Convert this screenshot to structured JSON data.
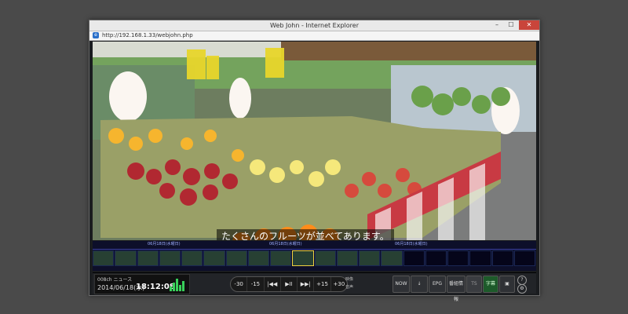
{
  "window": {
    "title": "Web John - Internet Explorer",
    "minimize": "–",
    "maximize": "☐",
    "close": "✕"
  },
  "address": {
    "ie_icon": "e",
    "url": "http://192.168.1.33/webjohn.php"
  },
  "video": {
    "subtitle": "たくさんのフルーツが並べてあります。"
  },
  "timeline": {
    "ruler_labels": [
      "06月18日(水曜日)",
      "06月18日(水曜日)",
      "06月18日(水曜日)"
    ],
    "thumbnails": [
      "frame",
      "frame",
      "frame",
      "frame",
      "frame",
      "frame",
      "frame",
      "frame",
      "frame",
      "current",
      "frame",
      "frame",
      "frame",
      "frame",
      "empty",
      "empty",
      "empty",
      "empty",
      "empty",
      "empty"
    ]
  },
  "controls": {
    "channel": "008ch ニュース",
    "date": "2014/06/18(水)",
    "time": "18:12:08",
    "playback": [
      "-30",
      "-15",
      "|◀◀",
      "▶II",
      "▶▶|",
      "+15",
      "+30"
    ],
    "volume_labels": [
      "映像",
      "音声"
    ],
    "buttons": [
      "NOW",
      "↓",
      "EPG",
      "番組情報",
      "TS",
      "字幕",
      "▣"
    ],
    "help_icon": "?",
    "settings_icon": "⚙"
  }
}
